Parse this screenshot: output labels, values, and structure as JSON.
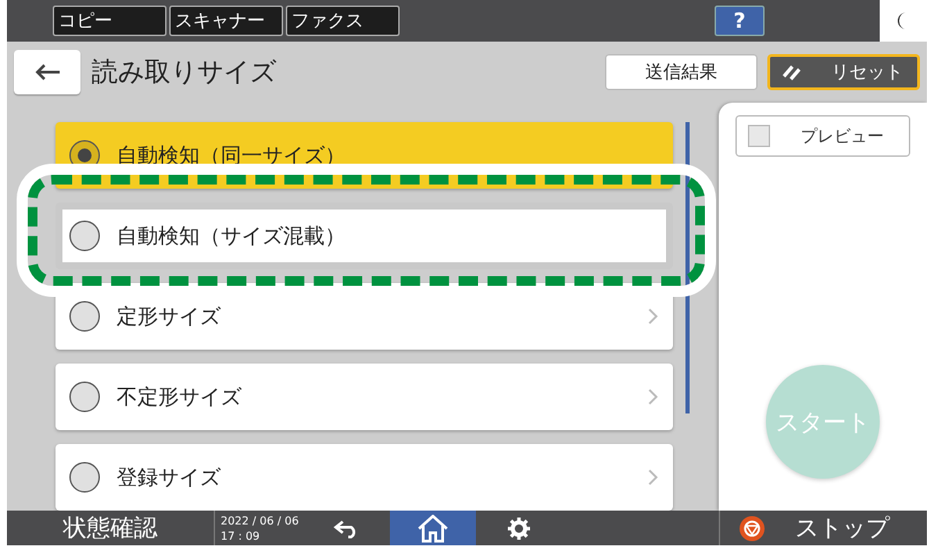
{
  "top_bar": {
    "tabs": [
      {
        "label": "コピー"
      },
      {
        "label": "スキャナー"
      },
      {
        "label": "ファクス"
      }
    ],
    "help": "?"
  },
  "header": {
    "title": "読み取りサイズ",
    "buttons": [
      {
        "label": "送信結果",
        "kind": "plain"
      },
      {
        "label": "リセット",
        "kind": "reset"
      }
    ]
  },
  "options": [
    {
      "label": "自動検知（同一サイズ）",
      "selected": true,
      "highlighted": false,
      "submenu": false
    },
    {
      "label": "自動検知（サイズ混載）",
      "selected": false,
      "highlighted": true,
      "submenu": false
    },
    {
      "label": "定形サイズ",
      "selected": false,
      "highlighted": false,
      "submenu": true
    },
    {
      "label": "不定形サイズ",
      "selected": false,
      "highlighted": false,
      "submenu": true
    },
    {
      "label": "登録サイズ",
      "selected": false,
      "highlighted": false,
      "submenu": true
    }
  ],
  "side_panel": {
    "preview": {
      "label": "プレビュー",
      "checked": false
    },
    "start": {
      "label": "スタート",
      "disabled": true
    }
  },
  "bottom_bar": {
    "status": "状態確認",
    "date": "2022 / 06 / 06",
    "time": "17 : 09",
    "stop": "ストップ"
  }
}
